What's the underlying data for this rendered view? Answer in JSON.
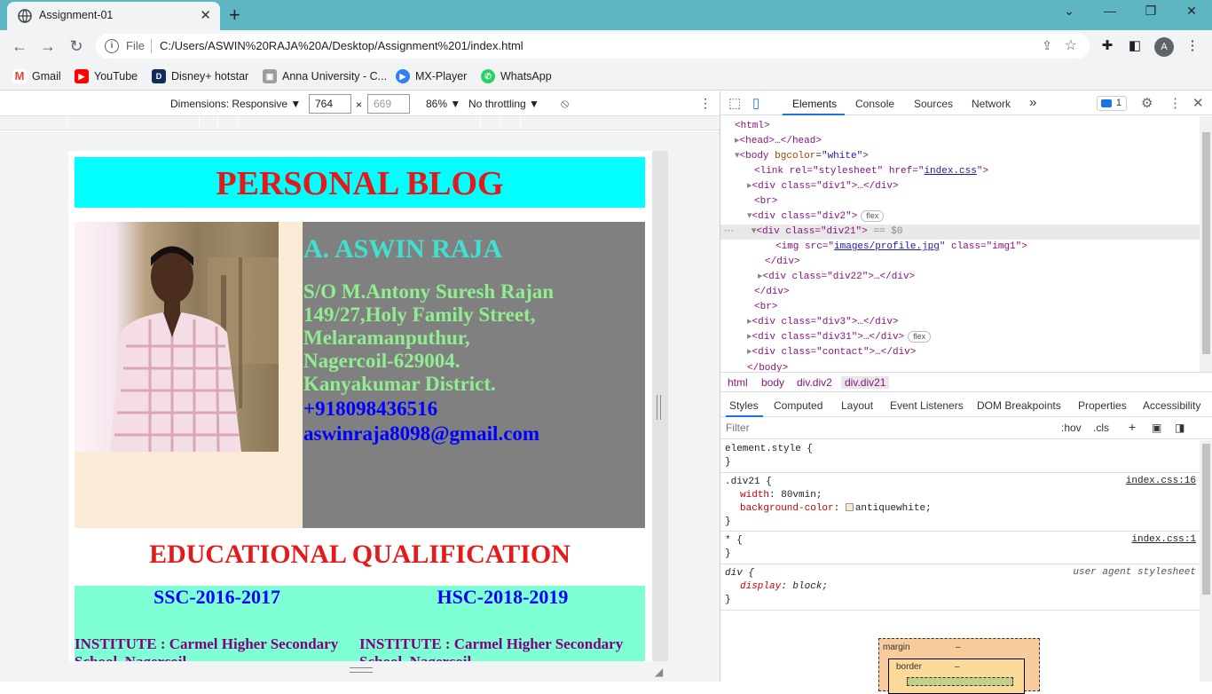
{
  "browser": {
    "tab_title": "Assignment-01",
    "omnibox_scheme": "File",
    "url": "C:/Users/ASWIN%20RAJA%20A/Desktop/Assignment%201/index.html",
    "profile_initial": "A",
    "bookmarks": [
      {
        "label": "Gmail",
        "icon_color": "#ea4335"
      },
      {
        "label": "YouTube",
        "icon_color": "#ff0000"
      },
      {
        "label": "Disney+ hotstar",
        "icon_color": "#102a5c"
      },
      {
        "label": "Anna University - C...",
        "icon_color": "#9e9e9e"
      },
      {
        "label": "MX-Player",
        "icon_color": "#2f7ff7"
      },
      {
        "label": "WhatsApp",
        "icon_color": "#25d366"
      }
    ]
  },
  "device_toolbar": {
    "dimensions_label": "Dimensions: Responsive ▼",
    "width": "764",
    "height": "669",
    "zoom": "86% ▼",
    "throttling": "No throttling ▼"
  },
  "webpage": {
    "header": "PERSONAL BLOG",
    "name": "A. ASWIN RAJA",
    "address_lines": [
      "S/O M.Antony Suresh Rajan",
      "149/27,Holy Family Street,",
      "Melaramanputhur,",
      "Nagercoil-629004.",
      "Kanyakumar District."
    ],
    "phone": "+918098436516",
    "email": "aswinraja8098@gmail.com",
    "edu_title": "EDUCATIONAL QUALIFICATION",
    "ssc": "SSC-2016-2017",
    "hsc": "HSC-2018-2019",
    "ssc_institute": "INSTITUTE : Carmel Higher Secondary",
    "hsc_institute": "INSTITUTE : Carmel Higher Secondary",
    "ssc_institute_cont": "School, Nagercoil",
    "hsc_institute_cont": "School, Nagercoil"
  },
  "devtools": {
    "tabs": [
      "Elements",
      "Console",
      "Sources",
      "Network"
    ],
    "more_tabs": "»",
    "issues_count": "1",
    "dom": {
      "html_open": "<html>",
      "head": "<head>…</head>",
      "body_tag": "<body",
      "body_attr": "bgcolor",
      "body_val": "\"white\"",
      "link_line_pre": "<link rel=\"stylesheet\" href=\"",
      "link_href": "index.css",
      "link_line_post": "\">",
      "div1": "<div class=\"div1\">…</div>",
      "br1": "<br>",
      "div2": "<div class=\"div2\">",
      "flex": "flex",
      "div21": "<div class=\"div21\">",
      "eq0": "== $0",
      "img_pre": "<img src=\"",
      "img_src": "images/profile.jpg",
      "img_post": "\" class=\"img1\">",
      "close_div_a": "</div>",
      "div22": "<div class=\"div22\">…</div>",
      "close_div_b": "</div>",
      "br2": "<br>",
      "div3": "<div class=\"div3\">…</div>",
      "div31": "<div class=\"div31\">…</div>",
      "contact": "<div class=\"contact\">…</div>",
      "body_close": "</body>"
    },
    "breadcrumbs": [
      "html",
      "body",
      "div.div2",
      "div.div21"
    ],
    "style_tabs": [
      "Styles",
      "Computed",
      "Layout",
      "Event Listeners",
      "DOM Breakpoints",
      "Properties",
      "Accessibility"
    ],
    "filter_placeholder": "Filter",
    "hov": ":hov",
    "cls": ".cls",
    "rules": {
      "element_style": "element.style {",
      "close": "}",
      "div21_selector": ".div21 {",
      "div21_src": "index.css:16",
      "width_prop": "width",
      "width_val": ": 80vmin;",
      "bg_prop": "background-color",
      "bg_val": "antiquewhite;",
      "star_selector": "* {",
      "star_src": "index.css:1",
      "div_selector": "div {",
      "div_src": "user agent stylesheet",
      "display_prop": "display",
      "display_val": ": block;"
    },
    "boxmodel": {
      "margin": "margin",
      "border": "border",
      "dash": "–"
    }
  }
}
